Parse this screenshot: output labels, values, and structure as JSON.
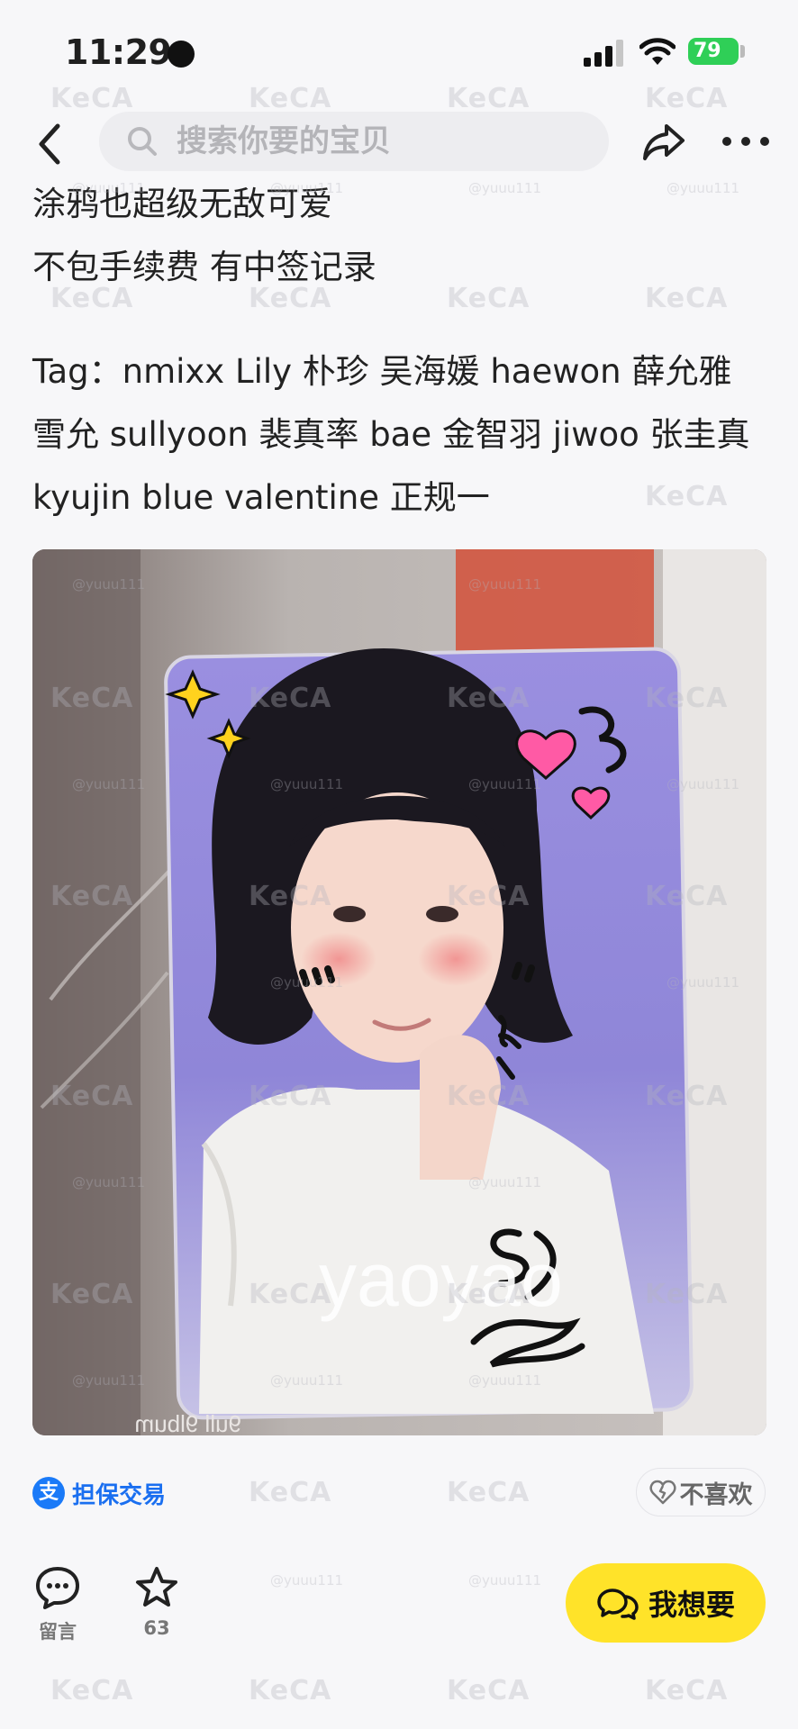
{
  "status_bar": {
    "time": "11:29",
    "battery": "79"
  },
  "nav": {
    "search_placeholder": "搜索你要的宝贝"
  },
  "description": {
    "line1": "涂鸦也超级无敌可爱",
    "line2": "不包手续费 有中签记录",
    "tags": "Tag：nmixx  Lily 朴珍 吴海媛 haewon 薛允雅 雪允 sullyoon 裴真率 bae 金智羽 jiwoo 张圭真 kyujin blue valentine 正规一"
  },
  "photo": {
    "overlay_text": "yaoyao",
    "card_bottom_text": "9ull 9lbum"
  },
  "guarantee": {
    "label": "担保交易",
    "icon": "alipay-icon"
  },
  "dislike": {
    "label": "不喜欢",
    "icon": "broken-heart-icon"
  },
  "bottom_bar": {
    "comment_label": "留言",
    "favorite_count": "63",
    "want_label": "我想要"
  },
  "watermark": {
    "brand": "KeCA",
    "handle": "@yuuu111"
  },
  "colors": {
    "accent_yellow": "#ffe329",
    "link_blue": "#1a6ff0",
    "battery_green": "#2fcf57"
  }
}
